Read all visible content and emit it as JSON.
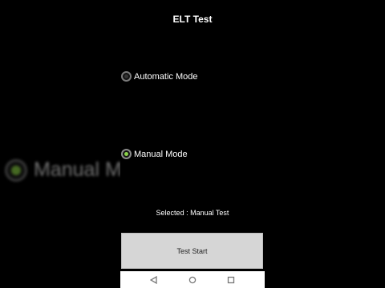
{
  "app": {
    "title": "ELT Test"
  },
  "modes": [
    {
      "label": "Automatic Mode",
      "selected": false
    },
    {
      "label": "Manual Mode",
      "selected": true
    }
  ],
  "status": {
    "selected_text": "Selected : Manual Test"
  },
  "actions": {
    "start_label": "Test Start"
  },
  "background_ghost": {
    "label": "Manual Mode"
  },
  "colors": {
    "accent": "#8bd14a",
    "button_bg": "#d6d6d6",
    "background": "#000000"
  },
  "navbar": {
    "icons": [
      "back-icon",
      "home-icon",
      "recents-icon"
    ]
  }
}
